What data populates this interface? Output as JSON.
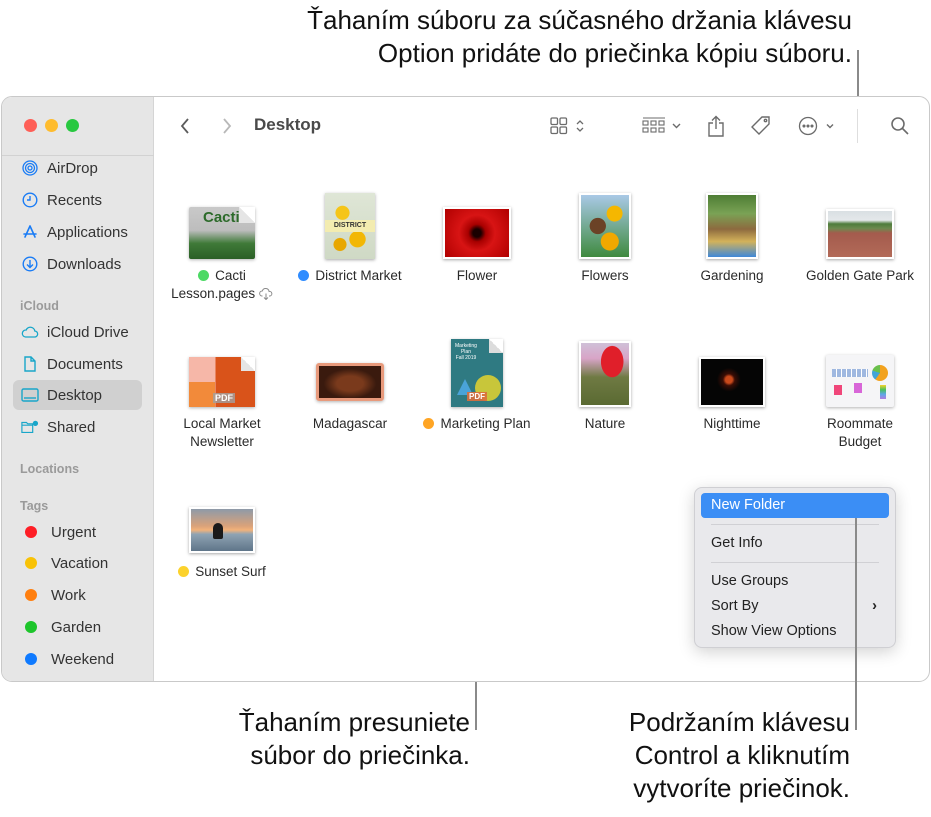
{
  "callouts": {
    "top": [
      "Ťahaním súboru za súčasného držania klávesu",
      "Option pridáte do priečinka kópiu súboru."
    ],
    "bottom_left": [
      "Ťahaním presuniete",
      "súbor do priečinka."
    ],
    "bottom_right": [
      "Podržaním klávesu",
      "Control a kliknutím",
      "vytvoríte priečinok."
    ]
  },
  "window": {
    "title": "Desktop",
    "traffic_lights": {
      "close": "#fe5f57",
      "minimize": "#febc2e",
      "zoom": "#28c840"
    }
  },
  "sidebar": {
    "favorites": [
      {
        "label": "AirDrop",
        "icon": "airdrop-icon"
      },
      {
        "label": "Recents",
        "icon": "clock-icon"
      },
      {
        "label": "Applications",
        "icon": "applications-icon"
      },
      {
        "label": "Downloads",
        "icon": "download-icon"
      }
    ],
    "icloud_header": "iCloud",
    "icloud": [
      {
        "label": "iCloud Drive",
        "icon": "cloud-icon"
      },
      {
        "label": "Documents",
        "icon": "document-icon"
      },
      {
        "label": "Desktop",
        "icon": "desktop-icon",
        "selected": true
      },
      {
        "label": "Shared",
        "icon": "shared-folder-icon"
      }
    ],
    "locations_header": "Locations",
    "tags_header": "Tags",
    "tags": [
      {
        "label": "Urgent",
        "color": "#fe1e26"
      },
      {
        "label": "Vacation",
        "color": "#f8c206"
      },
      {
        "label": "Work",
        "color": "#ff7f0f"
      },
      {
        "label": "Garden",
        "color": "#1dc52b"
      },
      {
        "label": "Weekend",
        "color": "#0f7aff"
      }
    ]
  },
  "toolbar": {
    "back": "back-icon",
    "forward": "forward-icon",
    "view_mode": "icon-view-icon",
    "group": "group-icon",
    "share": "share-icon",
    "tag": "tag-icon",
    "more": "more-icon",
    "search": "search-icon"
  },
  "files": [
    {
      "name": "Cacti Lesson.pages",
      "line1": "Cacti",
      "line2": "Lesson.pages",
      "tag": "#4cd964",
      "cloud": true
    },
    {
      "name": "District Market",
      "line1": "District Market",
      "line2": "",
      "tag": "#2f8cff"
    },
    {
      "name": "Flower",
      "line1": "Flower",
      "line2": ""
    },
    {
      "name": "Flowers",
      "line1": "Flowers",
      "line2": ""
    },
    {
      "name": "Gardening",
      "line1": "Gardening",
      "line2": ""
    },
    {
      "name": "Golden Gate Park",
      "line1": "Golden Gate Park",
      "line2": ""
    },
    {
      "name": "Local Market Newsletter",
      "line1": "Local Market",
      "line2": "Newsletter"
    },
    {
      "name": "Madagascar",
      "line1": "Madagascar",
      "line2": ""
    },
    {
      "name": "Marketing Plan",
      "line1": "Marketing Plan",
      "line2": "",
      "tag": "#ffa524"
    },
    {
      "name": "Nature",
      "line1": "Nature",
      "line2": ""
    },
    {
      "name": "Nighttime",
      "line1": "Nighttime",
      "line2": ""
    },
    {
      "name": "Roommate Budget",
      "line1": "Roommate",
      "line2": "Budget"
    },
    {
      "name": "Sunset Surf",
      "line1": "Sunset Surf",
      "line2": "",
      "tag": "#fcd22c"
    }
  ],
  "context_menu": {
    "items": [
      "New Folder",
      "Get Info",
      "Use Groups",
      "Sort By",
      "Show View Options"
    ],
    "highlighted": "New Folder",
    "submenu_arrow": "›"
  }
}
